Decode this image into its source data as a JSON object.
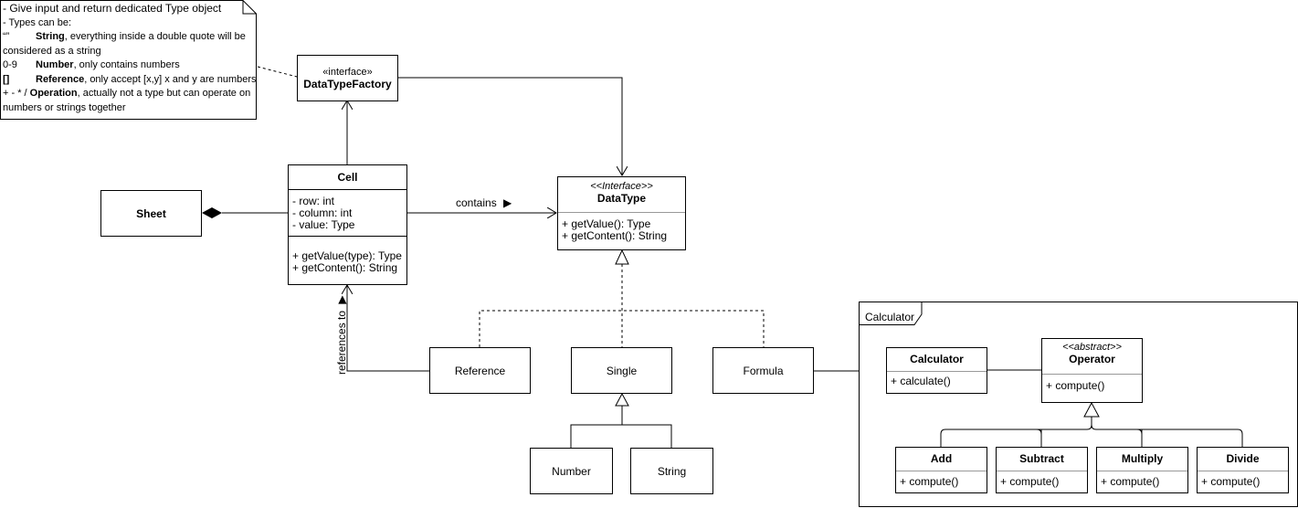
{
  "note": {
    "lines": [
      {
        "prefix": "",
        "bold": "",
        "text": "- Give input and return dedicated Type object"
      },
      {
        "prefix": "",
        "bold": "",
        "text": "- Types can be:"
      },
      {
        "prefix": "“”",
        "bold": "String",
        "text": ", everything inside a double quote will be"
      },
      {
        "prefix": "",
        "bold": "",
        "text": "considered as a string"
      },
      {
        "prefix": "0-9",
        "bold": "Number",
        "text": ", only contains numbers"
      },
      {
        "prefix": "[]",
        "bold": "Reference",
        "text": ", only accept [x,y] x and y are numbers"
      },
      {
        "prefix": "+ - * /",
        "bold": "Operation",
        "text": ", actually not a type but can operate on"
      },
      {
        "prefix": "",
        "bold": "",
        "text": "numbers or strings together"
      }
    ]
  },
  "classes": {
    "datatypefactory": {
      "stereotype": "«interface»",
      "name": "DataTypeFactory"
    },
    "sheet": {
      "name": "Sheet"
    },
    "cell": {
      "name": "Cell",
      "attributes": [
        "- row: int",
        "- column: int",
        "- value: Type"
      ],
      "methods": [
        "+ getValue(type): Type",
        "+ getContent(): String"
      ]
    },
    "datatype": {
      "stereotype": "<<Interface>>",
      "name": "DataType",
      "methods": [
        "+ getValue(): Type",
        "+ getContent(): String"
      ]
    },
    "reference": {
      "name": "Reference"
    },
    "single": {
      "name": "Single"
    },
    "formula": {
      "name": "Formula"
    },
    "number": {
      "name": "Number"
    },
    "string": {
      "name": "String"
    },
    "calculator": {
      "name": "Calculator",
      "methods": [
        "+ calculate()"
      ]
    },
    "operator": {
      "stereotype": "<<abstract>>",
      "name": "Operator",
      "methods": [
        "+ compute()"
      ]
    },
    "add": {
      "name": "Add",
      "methods": [
        "+ compute()"
      ]
    },
    "subtract": {
      "name": "Subtract",
      "methods": [
        "+ compute()"
      ]
    },
    "multiply": {
      "name": "Multiply",
      "methods": [
        "+ compute()"
      ]
    },
    "divide": {
      "name": "Divide",
      "methods": [
        "+ compute()"
      ]
    }
  },
  "frame": {
    "label": "Calculator"
  },
  "relations": {
    "contains": "contains",
    "contains_arrow": "▶",
    "references_to": "references to",
    "references_arrow": "▶"
  }
}
